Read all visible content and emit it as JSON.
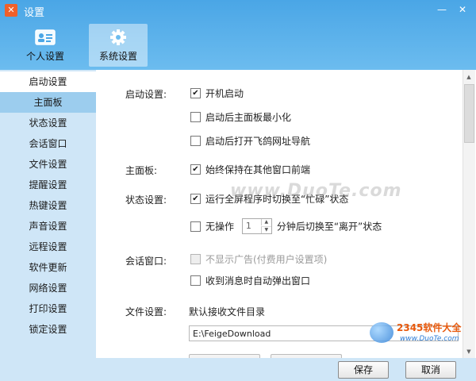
{
  "window": {
    "title": "设置",
    "logo_glyph": "✕",
    "controls": {
      "minimize": "—",
      "close": "✕"
    }
  },
  "tabs": [
    {
      "label": "个人设置",
      "icon": "id-card-icon"
    },
    {
      "label": "系统设置",
      "icon": "gear-icon",
      "active": true
    }
  ],
  "sidebar": {
    "items": [
      {
        "label": "启动设置",
        "state": "active"
      },
      {
        "label": "主面板",
        "state": "sub"
      },
      {
        "label": "状态设置"
      },
      {
        "label": "会话窗口"
      },
      {
        "label": "文件设置"
      },
      {
        "label": "提醒设置"
      },
      {
        "label": "热键设置"
      },
      {
        "label": "声音设置"
      },
      {
        "label": "远程设置"
      },
      {
        "label": "软件更新"
      },
      {
        "label": "网络设置"
      },
      {
        "label": "打印设置"
      },
      {
        "label": "锁定设置"
      }
    ]
  },
  "sections": {
    "startup": {
      "label": "启动设置:",
      "options": [
        {
          "label": "开机启动",
          "checked": true
        },
        {
          "label": "启动后主面板最小化",
          "checked": false
        },
        {
          "label": "启动后打开飞鸽网址导航",
          "checked": false
        }
      ]
    },
    "main_panel": {
      "label": "主面板:",
      "options": [
        {
          "label": "始终保持在其他窗口前端",
          "checked": true
        }
      ]
    },
    "status": {
      "label": "状态设置:",
      "busy_option": {
        "label": "运行全屏程序时切换至“忙碌”状态",
        "checked": true
      },
      "idle_option": {
        "prefix": "无操作",
        "value": "1",
        "suffix": "分钟后切换至“离开”状态",
        "checked": false
      }
    },
    "chat": {
      "label": "会话窗口:",
      "options": [
        {
          "label": "不显示广告(付费用户设置项)",
          "checked": false,
          "disabled": true
        },
        {
          "label": "收到消息时自动弹出窗口",
          "checked": false
        }
      ]
    },
    "file": {
      "label": "文件设置:",
      "dir_label": "默认接收文件目录",
      "dir_value": "E:\\FeigeDownload"
    }
  },
  "footer": {
    "save_label": "保存",
    "cancel_label": "取消"
  },
  "watermark": {
    "text": "www.DuoTe.com",
    "brand": "2345软件大全",
    "url": "www.DuoTe.com"
  },
  "colors": {
    "title_bar": "#4aa6e6",
    "sidebar_bg": "#cfe6f7",
    "sidebar_sub": "#9ccdee",
    "panel_bg": "#ffffff"
  }
}
